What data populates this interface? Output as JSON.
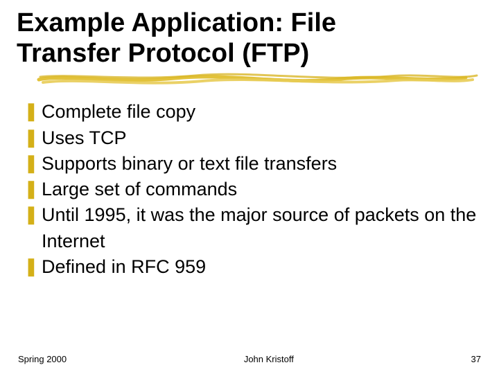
{
  "title": {
    "line1": "Example Application: File",
    "line2": "Transfer Protocol (FTP)"
  },
  "bullets": [
    "Complete file copy",
    "Uses TCP",
    "Supports binary or text file transfers",
    "Large set of commands",
    "Until 1995, it was the major source of packets on the Internet",
    "Defined in RFC 959"
  ],
  "footer": {
    "left": "Spring 2000",
    "center": "John Kristoff",
    "right": "37"
  },
  "colors": {
    "bullet_glyph": "#d4b018",
    "underline": "#e2c23a"
  }
}
